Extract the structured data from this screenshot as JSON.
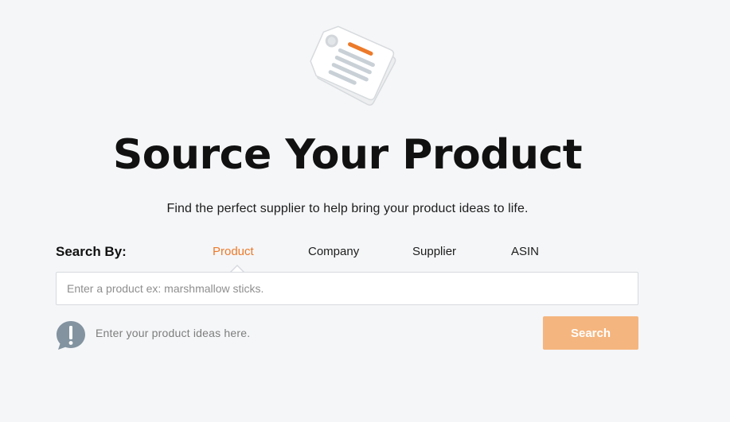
{
  "hero": {
    "icon": "price-tag-illustration",
    "title": "Source Your Product",
    "subtitle": "Find the perfect supplier to help bring your product ideas to life."
  },
  "search": {
    "label": "Search By:",
    "tabs": [
      {
        "label": "Product",
        "active": true
      },
      {
        "label": "Company",
        "active": false
      },
      {
        "label": "Supplier",
        "active": false
      },
      {
        "label": "ASIN",
        "active": false
      }
    ],
    "input_value": "",
    "placeholder": "Enter a product ex: marshmallow sticks.",
    "hint_icon": "exclamation-speech-bubble-icon",
    "hint": "Enter your product ideas here.",
    "button_label": "Search"
  },
  "colors": {
    "background": "#f5f6f8",
    "accent": "#ec7a2a",
    "button": "#f5b57e",
    "hint_icon": "#8393a0"
  }
}
